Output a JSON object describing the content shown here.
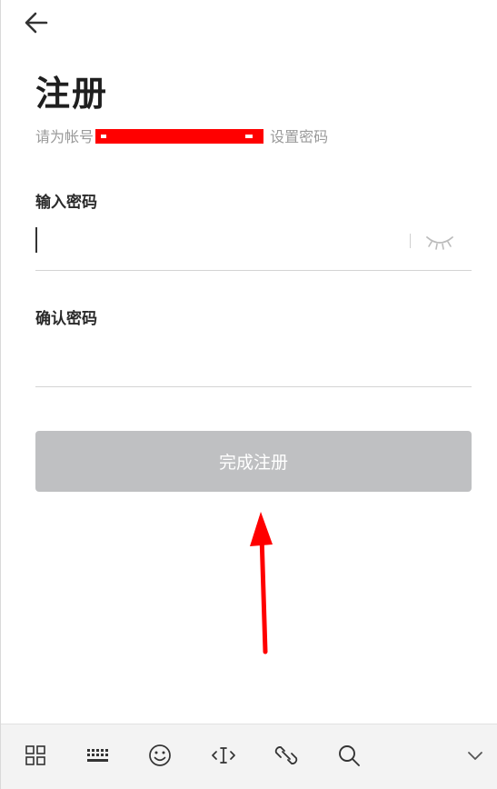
{
  "header": {
    "back_label": ""
  },
  "title": "注册",
  "subtitle": {
    "prefix": "请为帐号",
    "suffix": "设置密码"
  },
  "password": {
    "label": "输入密码",
    "value": "",
    "placeholder": ""
  },
  "confirm": {
    "label": "确认密码",
    "value": "",
    "placeholder": ""
  },
  "submit": {
    "label": "完成注册",
    "enabled": false
  },
  "colors": {
    "annotation_arrow": "#ff0000",
    "button_disabled": "#bfc0c2",
    "redaction": "#ff0000"
  },
  "toolbar": {
    "icons": [
      "grid-icon",
      "keyboard-icon",
      "emoji-icon",
      "text-cursor-icon",
      "link-icon",
      "search-icon",
      "chevron-down-icon"
    ]
  }
}
